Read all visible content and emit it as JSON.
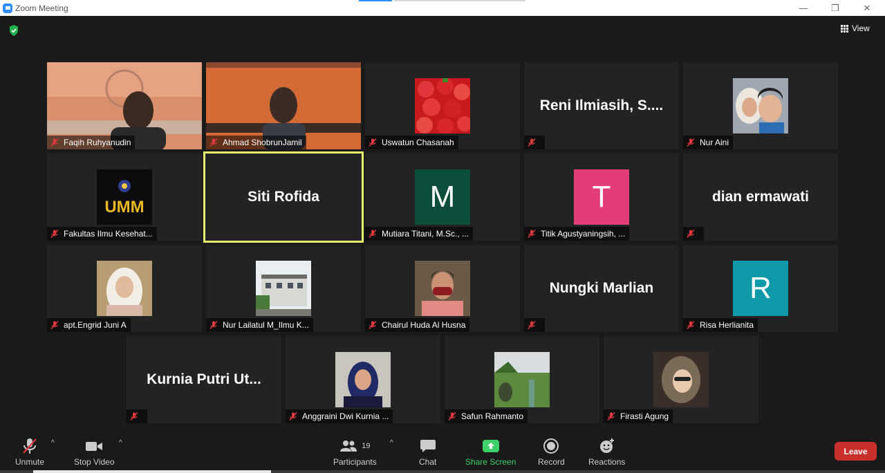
{
  "window": {
    "title": "Zoom Meeting",
    "minimize": "—",
    "maximize": "❐",
    "close": "✕"
  },
  "view": {
    "label": "View"
  },
  "tiles": [
    {
      "id": "faqih",
      "name": "Faqih Ruhyanudin",
      "display": "video",
      "muted": true
    },
    {
      "id": "ahmad",
      "name": "Ahmad ShobrunJamil",
      "display": "video",
      "muted": true
    },
    {
      "id": "uswatun",
      "name": "Uswatun Chasanah",
      "display": "photo",
      "muted": true
    },
    {
      "id": "reni",
      "name": "",
      "big_name": "Reni Ilmiasih, S....",
      "display": "name",
      "muted": true
    },
    {
      "id": "nur-aini",
      "name": "Nur Aini",
      "display": "photo",
      "muted": true
    },
    {
      "id": "fikes",
      "name": "Fakultas Ilmu Kesehat...",
      "display": "photo",
      "muted": true,
      "logo_text": "UMM"
    },
    {
      "id": "siti",
      "name": "",
      "big_name": "Siti Rofida",
      "display": "name",
      "muted": false,
      "active": true
    },
    {
      "id": "mutiara",
      "name": "Mutiara Titani, M.Sc., ...",
      "display": "letter",
      "letter": "M",
      "color": "#0c4d3c",
      "muted": true
    },
    {
      "id": "titik",
      "name": "Titik Agustyaningsih, ...",
      "display": "letter",
      "letter": "T",
      "color": "#e23c7b",
      "muted": true
    },
    {
      "id": "dian",
      "name": "",
      "big_name": "dian ermawati",
      "display": "name",
      "muted": true
    },
    {
      "id": "engrid",
      "name": "apt.Engrid Juni A",
      "display": "photo",
      "muted": true
    },
    {
      "id": "nur-lailatul",
      "name": "Nur Lailatul M_Ilmu K...",
      "display": "photo",
      "muted": true
    },
    {
      "id": "chairul",
      "name": "Chairul Huda Al Husna",
      "display": "photo",
      "muted": true
    },
    {
      "id": "nungki",
      "name": "",
      "big_name": "Nungki Marlian",
      "display": "name",
      "muted": true
    },
    {
      "id": "risa",
      "name": "Risa Herlianita",
      "display": "letter",
      "letter": "R",
      "color": "#0e9aa8",
      "muted": true
    },
    {
      "id": "kurnia",
      "name": "",
      "big_name": "Kurnia Putri Ut...",
      "display": "name",
      "muted": true
    },
    {
      "id": "anggraini",
      "name": "Anggraini Dwi Kurnia ...",
      "display": "photo",
      "muted": true
    },
    {
      "id": "safun",
      "name": "Safun Rahmanto",
      "display": "photo",
      "muted": true
    },
    {
      "id": "firasti",
      "name": "Firasti Agung",
      "display": "photo",
      "muted": true
    }
  ],
  "toolbar": {
    "unmute": "Unmute",
    "stop_video": "Stop Video",
    "participants": "Participants",
    "participants_count": "19",
    "chat": "Chat",
    "share_screen": "Share Screen",
    "record": "Record",
    "reactions": "Reactions",
    "leave": "Leave",
    "caret": "^"
  },
  "colors": {
    "accent": "#2d8cff",
    "leave": "#c9302c",
    "share": "#3fd06a",
    "active_border": "#e6f26b",
    "muted_mic": "#e0393e"
  }
}
